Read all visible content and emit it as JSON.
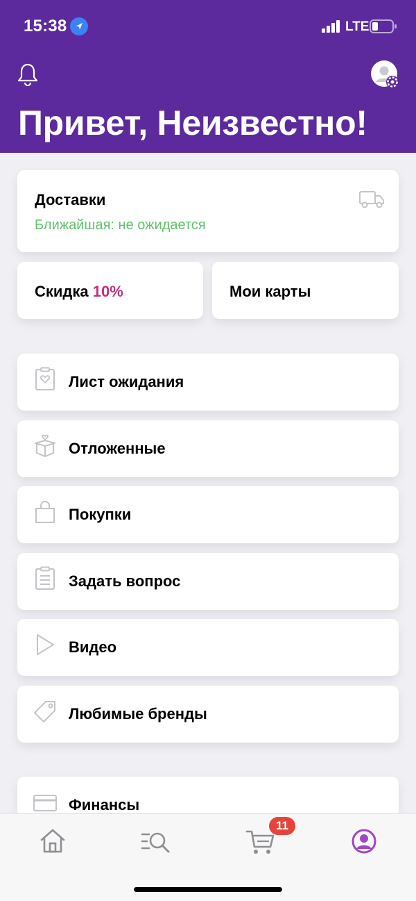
{
  "status_bar": {
    "time": "15:38",
    "network": "LTE",
    "icons": [
      "location-arrow-icon",
      "signal-bars-icon",
      "battery-icon"
    ]
  },
  "header": {
    "greeting": "Привет, Неизвестно!",
    "icons": [
      "bell-icon",
      "profile-settings-icon"
    ],
    "background_color": "#5c2a9d"
  },
  "delivery": {
    "title": "Доставки",
    "subtitle": "Ближайшая: не ожидается",
    "icon": "truck-icon",
    "subtitle_color": "#5ec26a"
  },
  "discount": {
    "label": "Скидка",
    "value": "10%",
    "value_color": "#c2307f"
  },
  "my_cards": {
    "label": "Мои карты"
  },
  "menu": [
    {
      "label": "Лист ожидания",
      "icon": "waitlist-icon"
    },
    {
      "label": "Отложенные",
      "icon": "gift-box-icon"
    },
    {
      "label": "Покупки",
      "icon": "shopping-bag-icon"
    },
    {
      "label": "Задать вопрос",
      "icon": "clipboard-icon"
    },
    {
      "label": "Видео",
      "icon": "play-icon"
    },
    {
      "label": "Любимые бренды",
      "icon": "tag-icon"
    }
  ],
  "finance": {
    "label": "Финансы",
    "icon": "card-icon"
  },
  "bottom_nav": {
    "items": [
      "home-icon",
      "catalog-search-icon",
      "cart-icon",
      "profile-icon"
    ],
    "cart_badge": "11",
    "active": "profile",
    "active_color": "#a044c8"
  }
}
